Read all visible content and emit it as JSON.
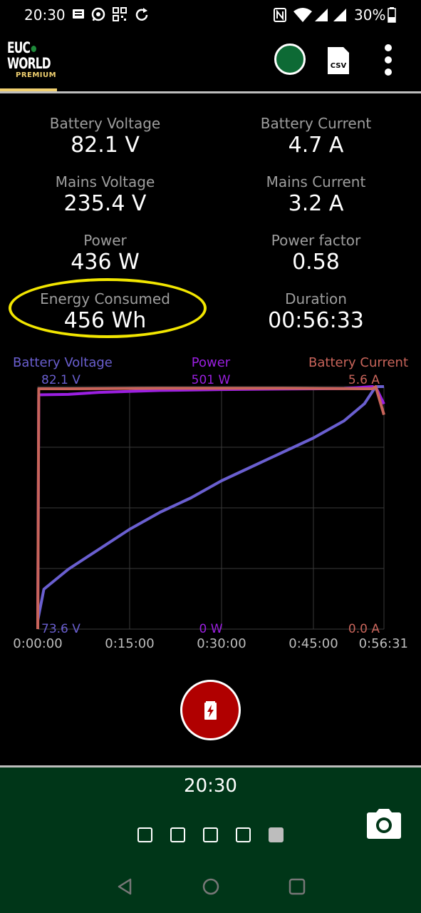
{
  "status_bar": {
    "time": "20:30",
    "battery_percent": "30%",
    "icons": [
      "message-icon",
      "whatsapp-icon",
      "qr-icon",
      "sync-icon",
      "nfc-icon",
      "wifi-icon",
      "signal-icon",
      "signal-icon",
      "battery-icon"
    ]
  },
  "app_bar": {
    "logo_line1": "EUC",
    "logo_line2": "WORLD",
    "logo_premium": "PREMIUM",
    "csv_label": "CSV",
    "connect_color": "#0d6a35"
  },
  "stats": [
    {
      "label": "Battery Voltage",
      "value": "82.1 V"
    },
    {
      "label": "Battery Current",
      "value": "4.7 A"
    },
    {
      "label": "Mains Voltage",
      "value": "235.4 V"
    },
    {
      "label": "Mains Current",
      "value": "3.2 A"
    },
    {
      "label": "Power",
      "value": "436 W"
    },
    {
      "label": "Power factor",
      "value": "0.58"
    },
    {
      "label": "Energy Consumed",
      "value": "456 Wh"
    },
    {
      "label": "Duration",
      "value": "00:56:33"
    }
  ],
  "chart_data": {
    "type": "line",
    "x_tick_labels": [
      "0:00:00",
      "0:15:00",
      "0:30:00",
      "0:45:00",
      "0:56:31"
    ],
    "x_range_seconds": [
      0,
      3391
    ],
    "grid": true,
    "series": [
      {
        "name": "Battery Voltage",
        "color": "#6a5fd0",
        "max_label": "82.1 V",
        "min_label": "73.6 V",
        "ylim": [
          73.6,
          82.1
        ],
        "x": [
          0,
          60,
          300,
          600,
          900,
          1200,
          1500,
          1800,
          2100,
          2400,
          2700,
          3000,
          3200,
          3310,
          3391
        ],
        "y": [
          73.9,
          75.0,
          75.7,
          76.4,
          77.1,
          77.7,
          78.2,
          78.8,
          79.3,
          79.8,
          80.3,
          80.9,
          81.5,
          82.1,
          82.1
        ]
      },
      {
        "name": "Power",
        "color": "#9a1fe0",
        "max_label": "501 W",
        "min_label": "0 W",
        "ylim": [
          0,
          501
        ],
        "x": [
          0,
          10,
          300,
          600,
          1200,
          1800,
          2400,
          3000,
          3280,
          3320,
          3391
        ],
        "y": [
          0,
          484,
          485,
          489,
          493,
          495,
          496,
          497,
          501,
          496,
          465
        ]
      },
      {
        "name": "Battery Current",
        "color": "#c8645a",
        "max_label": "5.6 A",
        "min_label": "0.0 A",
        "ylim": [
          0,
          5.6
        ],
        "x": [
          0,
          10,
          300,
          1200,
          2400,
          3200,
          3280,
          3310,
          3391
        ],
        "y": [
          0,
          5.55,
          5.55,
          5.56,
          5.56,
          5.55,
          5.55,
          5.6,
          4.95
        ]
      }
    ]
  },
  "charge_button_color": "#b00000",
  "bottom_panel": {
    "time": "20:30",
    "page_count": 5,
    "active_page": 4,
    "background": "#003618"
  }
}
